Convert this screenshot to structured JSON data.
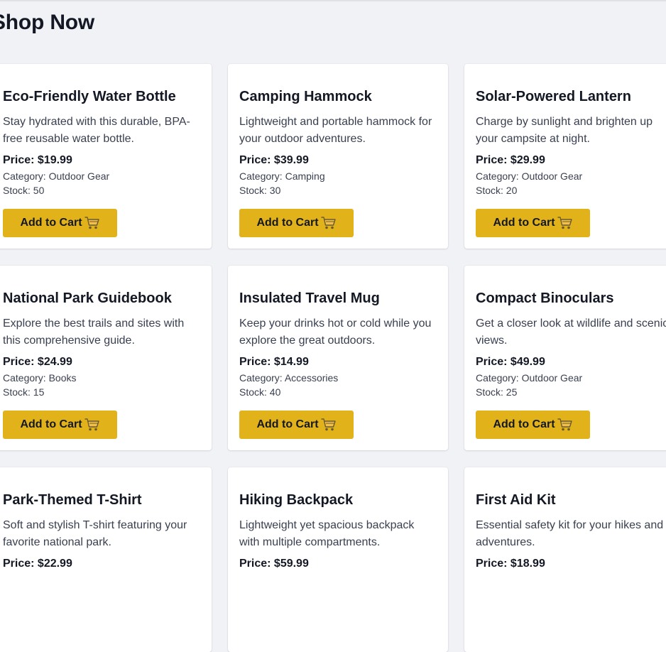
{
  "page": {
    "title": "Shop Now"
  },
  "colors": {
    "accent": "#e2b21b",
    "background": "#f1f2f6",
    "card": "#ffffff",
    "text": "#141824"
  },
  "button": {
    "label": "Add to Cart",
    "icon": "shopping-cart-icon"
  },
  "products": [
    {
      "name": "Eco-Friendly Water Bottle",
      "description": "Stay hydrated with this durable, BPA-free reusable water bottle.",
      "price": "Price: $19.99",
      "category": "Category: Outdoor Gear",
      "stock": "Stock: 50"
    },
    {
      "name": "Camping Hammock",
      "description": "Lightweight and portable hammock for your outdoor adventures.",
      "price": "Price: $39.99",
      "category": "Category: Camping",
      "stock": "Stock: 30"
    },
    {
      "name": "Solar-Powered Lantern",
      "description": "Charge by sunlight and brighten up your campsite at night.",
      "price": "Price: $29.99",
      "category": "Category: Outdoor Gear",
      "stock": "Stock: 20"
    },
    {
      "name": "National Park Guidebook",
      "description": "Explore the best trails and sites with this comprehensive guide.",
      "price": "Price: $24.99",
      "category": "Category: Books",
      "stock": "Stock: 15"
    },
    {
      "name": "Insulated Travel Mug",
      "description": "Keep your drinks hot or cold while you explore the great outdoors.",
      "price": "Price: $14.99",
      "category": "Category: Accessories",
      "stock": "Stock: 40"
    },
    {
      "name": "Compact Binoculars",
      "description": "Get a closer look at wildlife and scenic views.",
      "price": "Price: $49.99",
      "category": "Category: Outdoor Gear",
      "stock": "Stock: 25"
    },
    {
      "name": "Park-Themed T-Shirt",
      "description": "Soft and stylish T-shirt featuring your favorite national park.",
      "price": "Price: $22.99",
      "category": "",
      "stock": ""
    },
    {
      "name": "Hiking Backpack",
      "description": "Lightweight yet spacious backpack with multiple compartments.",
      "price": "Price: $59.99",
      "category": "",
      "stock": ""
    },
    {
      "name": "First Aid Kit",
      "description": "Essential safety kit for your hikes and adventures.",
      "price": "Price: $18.99",
      "category": "",
      "stock": ""
    }
  ]
}
